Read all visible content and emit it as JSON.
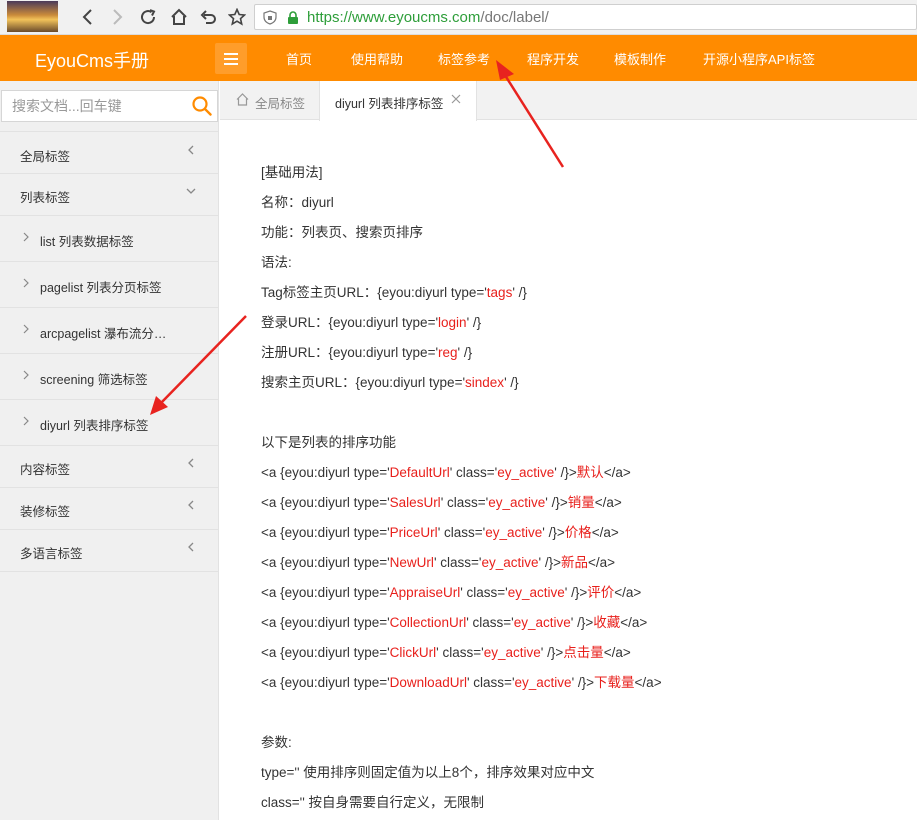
{
  "browser": {
    "url_scheme": "https://",
    "url_host": "www.eyoucms.com",
    "url_path": "/doc/label/"
  },
  "header": {
    "logo": "EyouCms手册",
    "nav": [
      "首页",
      "使用帮助",
      "标签参考",
      "程序开发",
      "模板制作",
      "开源小程序API标签"
    ]
  },
  "sidebar": {
    "search_placeholder": "搜索文档...回车键",
    "groups": [
      {
        "label": "全局标签"
      },
      {
        "label": "列表标签"
      },
      {
        "label": "内容标签"
      },
      {
        "label": "装修标签"
      },
      {
        "label": "多语言标签"
      }
    ],
    "list_children": [
      {
        "label": "list 列表数据标签"
      },
      {
        "label": "pagelist 列表分页标签"
      },
      {
        "label": "arcpagelist 瀑布流分…"
      },
      {
        "label": "screening 筛选标签"
      },
      {
        "label": "diyurl 列表排序标签"
      }
    ]
  },
  "tabs": {
    "home": "全局标签",
    "active": "diyurl 列表排序标签"
  },
  "content": {
    "basic_heading": "[基础用法]",
    "name_line": "名称：diyurl",
    "func_line": "功能：列表页、搜索页排序",
    "syntax_line": "语法:",
    "syntax": [
      {
        "pre": "Tag标签主页URL：{eyou:diyurl type='",
        "val": "tags",
        "post": "' /}"
      },
      {
        "pre": "登录URL：{eyou:diyurl type='",
        "val": "login",
        "post": "' /}"
      },
      {
        "pre": "注册URL：{eyou:diyurl type='",
        "val": "reg",
        "post": "' /}"
      },
      {
        "pre": "搜索主页URL：{eyou:diyurl type='",
        "val": "sindex",
        "post": "' /}"
      }
    ],
    "sort_heading": "以下是列表的排序功能",
    "sort_lines": [
      {
        "type": "DefaultUrl",
        "cls": "ey_active",
        "text": "默认"
      },
      {
        "type": "SalesUrl",
        "cls": "ey_active",
        "text": "销量"
      },
      {
        "type": "PriceUrl",
        "cls": "ey_active",
        "text": "价格"
      },
      {
        "type": "NewUrl",
        "cls": "ey_active",
        "text": "新品"
      },
      {
        "type": "AppraiseUrl",
        "cls": "ey_active",
        "text": "评价"
      },
      {
        "type": "CollectionUrl",
        "cls": "ey_active",
        "text": "收藏"
      },
      {
        "type": "ClickUrl",
        "cls": "ey_active",
        "text": "点击量"
      },
      {
        "type": "DownloadUrl",
        "cls": "ey_active",
        "text": "下载量"
      }
    ],
    "sort_tokens": {
      "p1": "<a {eyou:diyurl type='",
      "p2": "' class='",
      "p3": "' /}>",
      "p4": "</a>"
    },
    "params_heading": "参数:",
    "param_type": "type='' 使用排序则固定值为以上8个，排序效果对应中文",
    "param_class": "class='' 按自身需要自行定义，无限制"
  },
  "colors": {
    "brand_orange": "#ff8b00",
    "value_red": "#e8201c",
    "annotation_red": "#e8231f"
  }
}
